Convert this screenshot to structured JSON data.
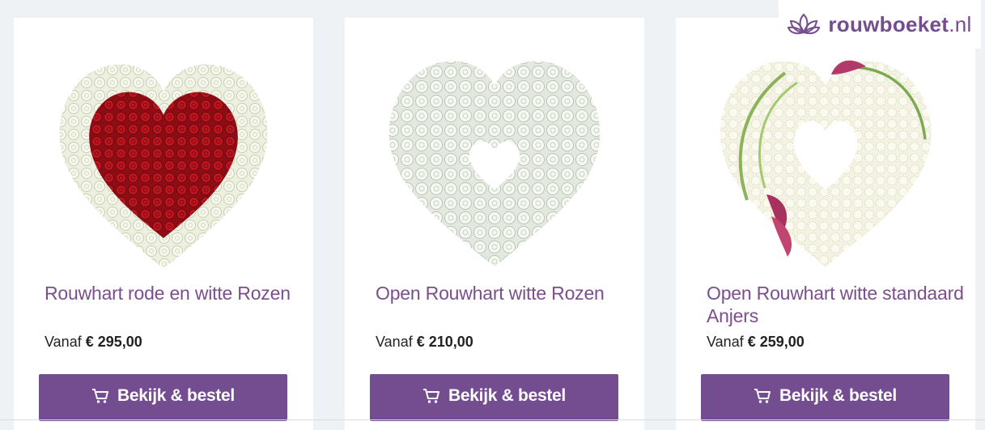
{
  "logo": {
    "name": "rouwboeket",
    "tld": ".nl",
    "icon": "lotus-icon",
    "color": "#744c90"
  },
  "products": [
    {
      "title": "Rouwhart rode en witte Rozen",
      "price_prefix": "Vanaf",
      "price": "€ 295,00",
      "button_label": "Bekijk & bestel",
      "image": "red-white-rose-heart"
    },
    {
      "title": "Open Rouwhart witte Rozen",
      "price_prefix": "Vanaf",
      "price": "€ 210,00",
      "button_label": "Bekijk & bestel",
      "image": "open-white-rose-heart"
    },
    {
      "title": "Open Rouwhart witte standaard Anjers",
      "price_prefix": "Vanaf",
      "price": "€ 259,00",
      "button_label": "Bekijk & bestel",
      "image": "open-white-carnation-heart"
    }
  ],
  "colors": {
    "accent": "#744c90",
    "title": "#7a4f8c",
    "background": "#eef2f5"
  }
}
